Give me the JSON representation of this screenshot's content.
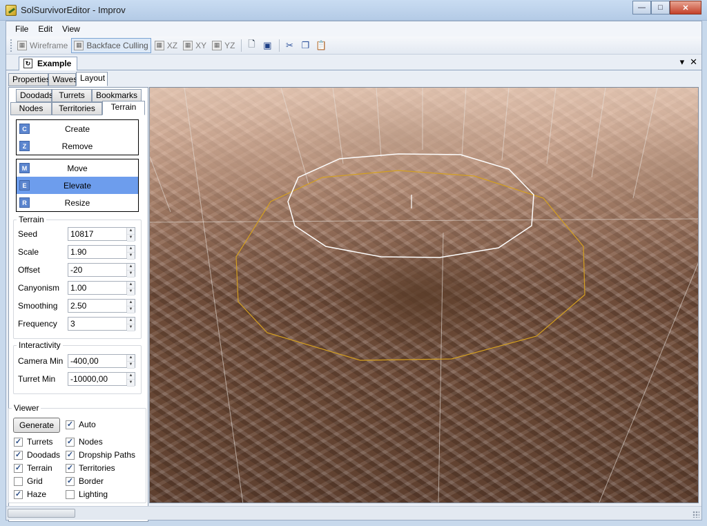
{
  "window": {
    "title": "SolSurvivorEditor - Improv",
    "minimize_glyph": "—",
    "maximize_glyph": "□",
    "close_glyph": "✕"
  },
  "menu": [
    "File",
    "Edit",
    "View"
  ],
  "toolbar": {
    "wireframe": "Wireframe",
    "backface_culling": "Backface Culling",
    "xz": "XZ",
    "xy": "XY",
    "yz": "YZ",
    "new_icon": "new-document-icon",
    "save_icon": "save-icon",
    "cut_icon": "cut-icon",
    "copy_icon": "copy-icon",
    "paste_icon": "paste-icon"
  },
  "document": {
    "tab_label": "Example",
    "dropdown_glyph": "▾",
    "close_glyph": "✕"
  },
  "main_tabs": [
    "Properties",
    "Waves",
    "Layout"
  ],
  "sub_tabs_row1": [
    "Doodads",
    "Turrets",
    "Bookmarks"
  ],
  "sub_tabs_row2": [
    "Nodes",
    "Territories",
    "Terrain"
  ],
  "tools_group1": [
    {
      "key": "C",
      "label": "Create"
    },
    {
      "key": "Z",
      "label": "Remove"
    }
  ],
  "tools_group2": [
    {
      "key": "M",
      "label": "Move"
    },
    {
      "key": "E",
      "label": "Elevate"
    },
    {
      "key": "R",
      "label": "Resize"
    }
  ],
  "terrain": {
    "legend": "Terrain",
    "fields": [
      {
        "label": "Seed",
        "value": "10817"
      },
      {
        "label": "Scale",
        "value": "1.90"
      },
      {
        "label": "Offset",
        "value": "-20"
      },
      {
        "label": "Canyonism",
        "value": "1.00"
      },
      {
        "label": "Smoothing",
        "value": "2.50"
      },
      {
        "label": "Frequency",
        "value": "3"
      }
    ]
  },
  "interactivity": {
    "legend": "Interactivity",
    "fields": [
      {
        "label": "Camera Min",
        "value": "-400,00"
      },
      {
        "label": "Turret Min",
        "value": "-10000,00"
      }
    ]
  },
  "viewer": {
    "legend": "Viewer",
    "generate": "Generate",
    "checks": [
      {
        "label": "Auto",
        "checked": true
      },
      {
        "label": "Turrets",
        "checked": true
      },
      {
        "label": "Nodes",
        "checked": true
      },
      {
        "label": "Doodads",
        "checked": true
      },
      {
        "label": "Dropship Paths",
        "checked": true
      },
      {
        "label": "Terrain",
        "checked": true
      },
      {
        "label": "Territories",
        "checked": true
      },
      {
        "label": "Grid",
        "checked": false
      },
      {
        "label": "Border",
        "checked": true
      },
      {
        "label": "Haze",
        "checked": true
      },
      {
        "label": "Lighting",
        "checked": false
      }
    ]
  },
  "colors": {
    "selected_tool": "#6d9ded",
    "key_badge": "#5c86cf",
    "selection_ring": "#ffffff",
    "brush_ring": "#d4a020"
  }
}
